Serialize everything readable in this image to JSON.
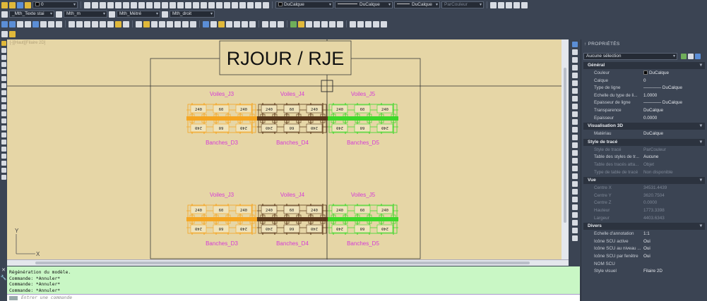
{
  "toolbar1": {
    "layer_value": "0",
    "color_value": "DuCalque",
    "linetype_value": "DuCalque",
    "lineweight_value": "DuCalque",
    "plotstyle_value": "ParCouleur"
  },
  "toolbar2": {
    "text_style": "_Mth_Texte stai",
    "dim_style": "Mth_m",
    "table_style": "Mth_Métré",
    "mleader_style": "Mth_droit"
  },
  "viewport": {
    "label": "[-][Haut][Filaire 2D]",
    "title": "RJOUR / RJE",
    "ucs_y": "Y",
    "ucs_x": "X",
    "background": "#e6d6a6"
  },
  "drawing": {
    "rows": [
      {
        "groups": [
          {
            "wall": "Voiles_J3",
            "form": "Banches_D3",
            "color": "#f5a623",
            "top": [
              "240",
              "60",
              "240"
            ],
            "bottom": [
              "240",
              "60",
              "240"
            ]
          },
          {
            "wall": "Voiles_J4",
            "form": "Banches_D4",
            "color": "#5b3a1c",
            "top": [
              "240",
              "60",
              "240"
            ],
            "bottom": [
              "240",
              "60",
              "240"
            ]
          },
          {
            "wall": "Voiles_J5",
            "form": "Banches_D5",
            "color": "#3ed82a",
            "top": [
              "240",
              "60",
              "240"
            ],
            "bottom": [
              "240",
              "60",
              "240"
            ]
          }
        ]
      },
      {
        "groups": [
          {
            "wall": "Voiles_J3",
            "form": "Banches_D3",
            "color": "#f5a623",
            "top": [
              "240",
              "60",
              "240"
            ],
            "bottom": [
              "240",
              "60",
              "240"
            ]
          },
          {
            "wall": "Voiles_J4",
            "form": "Banches_D4",
            "color": "#5b3a1c",
            "top": [
              "240",
              "60",
              "240"
            ],
            "bottom": [
              "240",
              "60",
              "240"
            ]
          },
          {
            "wall": "Voiles_J5",
            "form": "Banches_D5",
            "color": "#3ed82a",
            "top": [
              "240",
              "60",
              "240"
            ],
            "bottom": [
              "240",
              "60",
              "240"
            ]
          }
        ]
      }
    ],
    "label_color": "#d53ad6"
  },
  "properties": {
    "header": "PROPRIÉTÉS",
    "selection": "Aucune sélection",
    "categories": [
      {
        "name": "Général",
        "rows": [
          {
            "k": "Couleur",
            "v": "DuCalque"
          },
          {
            "k": "Calque",
            "v": "0"
          },
          {
            "k": "Type de ligne",
            "v": "———— DuCalque"
          },
          {
            "k": "Echelle du type de li...",
            "v": "1.0000"
          },
          {
            "k": "Epaisseur de ligne",
            "v": "———— DuCalque"
          },
          {
            "k": "Transparence",
            "v": "DuCalque"
          },
          {
            "k": "Epaisseur",
            "v": "0.0000"
          }
        ]
      },
      {
        "name": "Visualisation 3D",
        "rows": [
          {
            "k": "Matériau",
            "v": "DuCalque"
          }
        ]
      },
      {
        "name": "Style de tracé",
        "rows": [
          {
            "k": "Style de tracé",
            "v": "ParCouleur",
            "dis": true
          },
          {
            "k": "Table des styles de tr...",
            "v": "Aucune"
          },
          {
            "k": "Table des tracés atta...",
            "v": "Objet",
            "dis": true
          },
          {
            "k": "Type de table de tracé",
            "v": "Non disponible",
            "dis": true
          }
        ]
      },
      {
        "name": "Vue",
        "rows": [
          {
            "k": "Centre X",
            "v": "34531.4439",
            "dis": true
          },
          {
            "k": "Centre Y",
            "v": "3620.7504",
            "dis": true
          },
          {
            "k": "Centre Z",
            "v": "0.0000",
            "dis": true
          },
          {
            "k": "Hauteur",
            "v": "1773.3398",
            "dis": true
          },
          {
            "k": "Largeur",
            "v": "4403.6343",
            "dis": true
          }
        ]
      },
      {
        "name": "Divers",
        "rows": [
          {
            "k": "Echelle d'annotation",
            "v": "1:1"
          },
          {
            "k": "Icône SCU active",
            "v": "Oui"
          },
          {
            "k": "Icône SCU au niveau ...",
            "v": "Oui"
          },
          {
            "k": "Icône SCU par fenêtre",
            "v": "Oui"
          },
          {
            "k": "NOM SCU",
            "v": ""
          },
          {
            "k": "Style visuel",
            "v": "Filaire 2D"
          }
        ]
      }
    ]
  },
  "command": {
    "lines": [
      "Régénération du modèle.",
      "Commande: *Annuler*",
      "Commande: *Annuler*",
      "Commande: *Annuler*"
    ],
    "placeholder": "Entrer une commande"
  }
}
